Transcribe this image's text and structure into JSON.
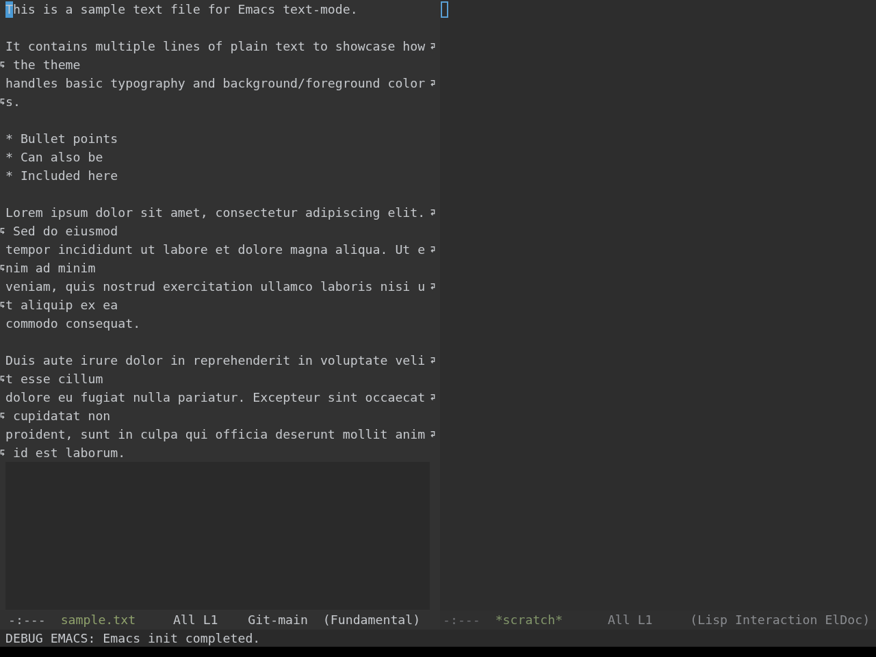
{
  "windows": [
    {
      "selected": true,
      "paragraphs": [
        {
          "lines": [
            {
              "rows": [
                "This is a sample text file for Emacs text-mode."
              ]
            }
          ]
        },
        {
          "lines": [
            {
              "rows": [
                "It contains multiple lines of plain text to showcase how",
                " the theme"
              ]
            },
            {
              "rows": [
                "handles basic typography and background/foreground color",
                "s."
              ]
            }
          ]
        },
        {
          "lines": [
            {
              "rows": [
                "* Bullet points"
              ]
            },
            {
              "rows": [
                "* Can also be"
              ]
            },
            {
              "rows": [
                "* Included here"
              ]
            }
          ]
        },
        {
          "lines": [
            {
              "rows": [
                "Lorem ipsum dolor sit amet, consectetur adipiscing elit.",
                " Sed do eiusmod"
              ]
            },
            {
              "rows": [
                "tempor incididunt ut labore et dolore magna aliqua. Ut e",
                "nim ad minim"
              ]
            },
            {
              "rows": [
                "veniam, quis nostrud exercitation ullamco laboris nisi u",
                "t aliquip ex ea"
              ]
            },
            {
              "rows": [
                "commodo consequat."
              ]
            }
          ]
        },
        {
          "lines": [
            {
              "rows": [
                "Duis aute irure dolor in reprehenderit in voluptate veli",
                "t esse cillum"
              ]
            },
            {
              "rows": [
                "dolore eu fugiat nulla pariatur. Excepteur sint occaecat",
                " cupidatat non"
              ]
            },
            {
              "rows": [
                "proident, sunt in culpa qui officia deserunt mollit anim",
                " id est laborum."
              ]
            }
          ]
        }
      ],
      "mode_line": {
        "status": "-:---",
        "buffer_name": "sample.txt",
        "position": "All L1",
        "vc": "Git-main",
        "modes": "(Fundamental)"
      }
    },
    {
      "selected": false,
      "mode_line": {
        "status": "-:---",
        "buffer_name": "*scratch*",
        "position": "All L1",
        "modes": "(Lisp Interaction ElDoc)"
      }
    }
  ],
  "echo_area": "DEBUG EMACS: Emacs init completed."
}
